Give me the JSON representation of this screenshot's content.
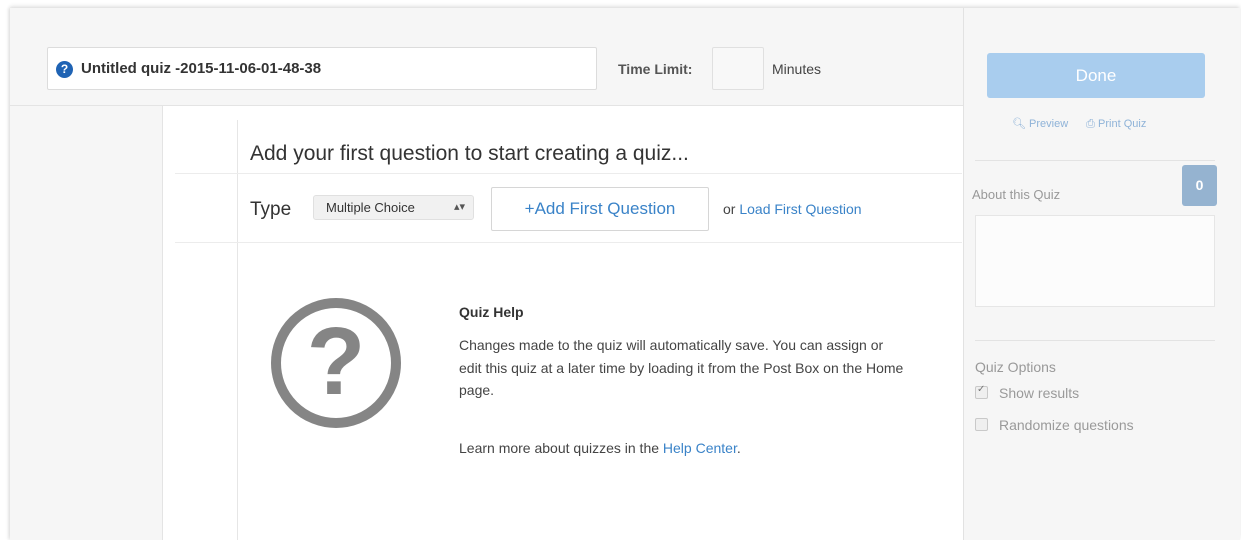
{
  "header": {
    "quiz_title": "Untitled quiz -2015-11-06-01-48-38",
    "time_limit_label": "Time Limit:",
    "time_limit_value": "",
    "minutes_label": "Minutes"
  },
  "editor": {
    "prompt_title": "Add your first question to start creating a quiz...",
    "type_label": "Type",
    "type_selected": "Multiple Choice",
    "add_button_label": "+Add First Question",
    "or_text": "or",
    "load_link_label": "Load First Question"
  },
  "help": {
    "title": "Quiz Help",
    "body": "Changes made to the quiz will automatically save. You can assign or edit this quiz at a later time by loading it from the Post Box on the Home page.",
    "more_prefix": "Learn more about quizzes in the",
    "more_link": "Help Center",
    "more_suffix": "."
  },
  "sidebar": {
    "done_label": "Done",
    "preview_label": "Preview",
    "print_label": "Print Quiz",
    "about_label": "About this Quiz",
    "about_count": "0",
    "options_label": "Quiz Options",
    "options": [
      {
        "label": "Show results",
        "checked": true
      },
      {
        "label": "Randomize questions",
        "checked": false
      }
    ]
  },
  "colors": {
    "accent": "#3a83c8",
    "done_button": "#a9cdee",
    "badge": "#95b3d0",
    "title_icon": "#1f63b4"
  },
  "icons": [
    "question-circle-icon",
    "help-question-icon",
    "select-arrows-icon",
    "magnifier-icon",
    "printer-icon",
    "checkbox-icon"
  ]
}
